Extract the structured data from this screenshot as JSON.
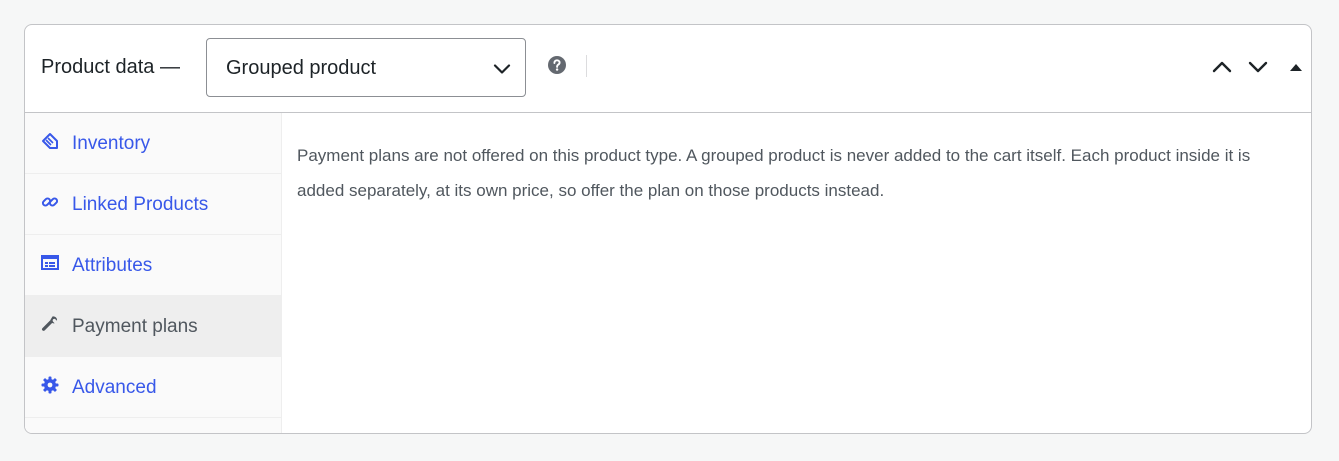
{
  "header": {
    "title": "Product data —",
    "product_type": {
      "selected": "Grouped product"
    }
  },
  "icons": {
    "help": "help-icon",
    "move_up": "chevron-up-icon",
    "move_down": "chevron-down-icon",
    "toggle": "caret-up-icon"
  },
  "sidebar": {
    "items": [
      {
        "label": "Inventory",
        "icon": "tag-icon",
        "active": false
      },
      {
        "label": "Linked Products",
        "icon": "link-icon",
        "active": false
      },
      {
        "label": "Attributes",
        "icon": "list-table-icon",
        "active": false
      },
      {
        "label": "Payment plans",
        "icon": "wrench-icon",
        "active": true
      },
      {
        "label": "Advanced",
        "icon": "gear-icon",
        "active": false
      }
    ]
  },
  "main": {
    "message": "Payment plans are not offered on this product type. A grouped product is never added to the cart itself. Each product inside it is added separately, at its own price, so offer the plan on those products instead."
  },
  "colors": {
    "link": "#3858e9",
    "active_text": "#50575e",
    "border": "#c3c4c7"
  }
}
